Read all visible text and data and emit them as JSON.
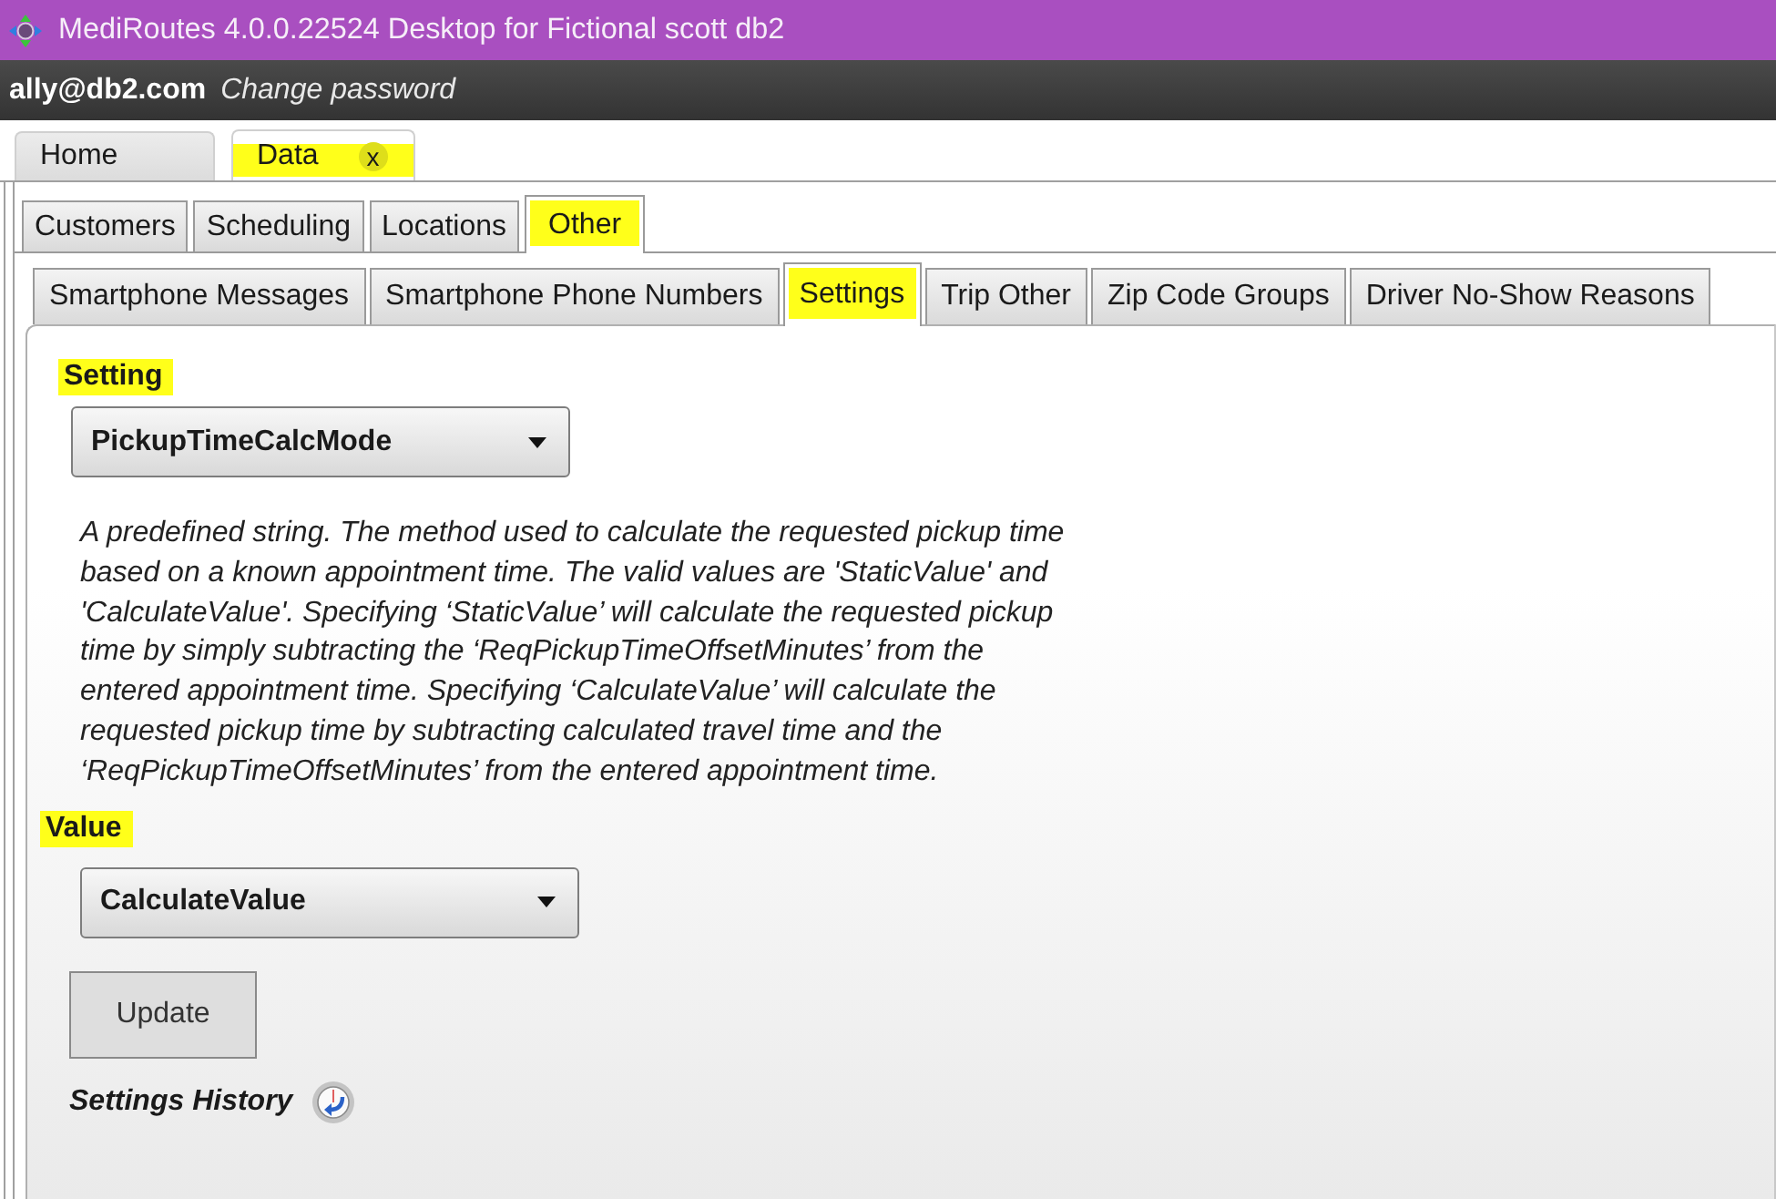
{
  "window": {
    "title": "MediRoutes 4.0.0.22524 Desktop for Fictional scott db2"
  },
  "user_bar": {
    "email": "ally@db2.com",
    "change_password": "Change password"
  },
  "main_tabs": [
    {
      "label": "Home",
      "selected": false,
      "highlighted": false
    },
    {
      "label": "Data",
      "selected": true,
      "highlighted": true,
      "close": "x"
    }
  ],
  "data_tabs": [
    {
      "label": "Customers",
      "selected": false,
      "highlighted": false
    },
    {
      "label": "Scheduling",
      "selected": false,
      "highlighted": false
    },
    {
      "label": "Locations",
      "selected": false,
      "highlighted": false
    },
    {
      "label": "Other",
      "selected": true,
      "highlighted": true
    }
  ],
  "other_tabs": [
    {
      "label": "Smartphone Messages",
      "selected": false,
      "highlighted": false
    },
    {
      "label": "Smartphone Phone Numbers",
      "selected": false,
      "highlighted": false
    },
    {
      "label": "Settings",
      "selected": true,
      "highlighted": true
    },
    {
      "label": "Trip Other",
      "selected": false,
      "highlighted": false
    },
    {
      "label": "Zip Code Groups",
      "selected": false,
      "highlighted": false
    },
    {
      "label": "Driver No-Show Reasons",
      "selected": false,
      "highlighted": false
    }
  ],
  "settings_panel": {
    "setting_label": {
      "text": "Setting",
      "highlighted": true
    },
    "setting_dropdown": {
      "value": "PickupTimeCalcMode"
    },
    "description": "A predefined string. The method used to calculate the requested pickup time based on a known appointment time. The valid values are 'StaticValue' and 'CalculateValue'. Specifying ‘StaticValue’ will calculate the requested pickup time by simply subtracting the ‘ReqPickupTimeOffsetMinutes’ from the entered appointment time. Specifying ‘CalculateValue’ will calculate the requested pickup time by subtracting calculated travel time and the ‘ReqPickupTimeOffsetMinutes’ from the entered appointment time.",
    "value_label": {
      "text": "Value",
      "highlighted": true
    },
    "value_dropdown": {
      "value": "CalculateValue"
    },
    "update_button": "Update",
    "history_label": "Settings History"
  }
}
